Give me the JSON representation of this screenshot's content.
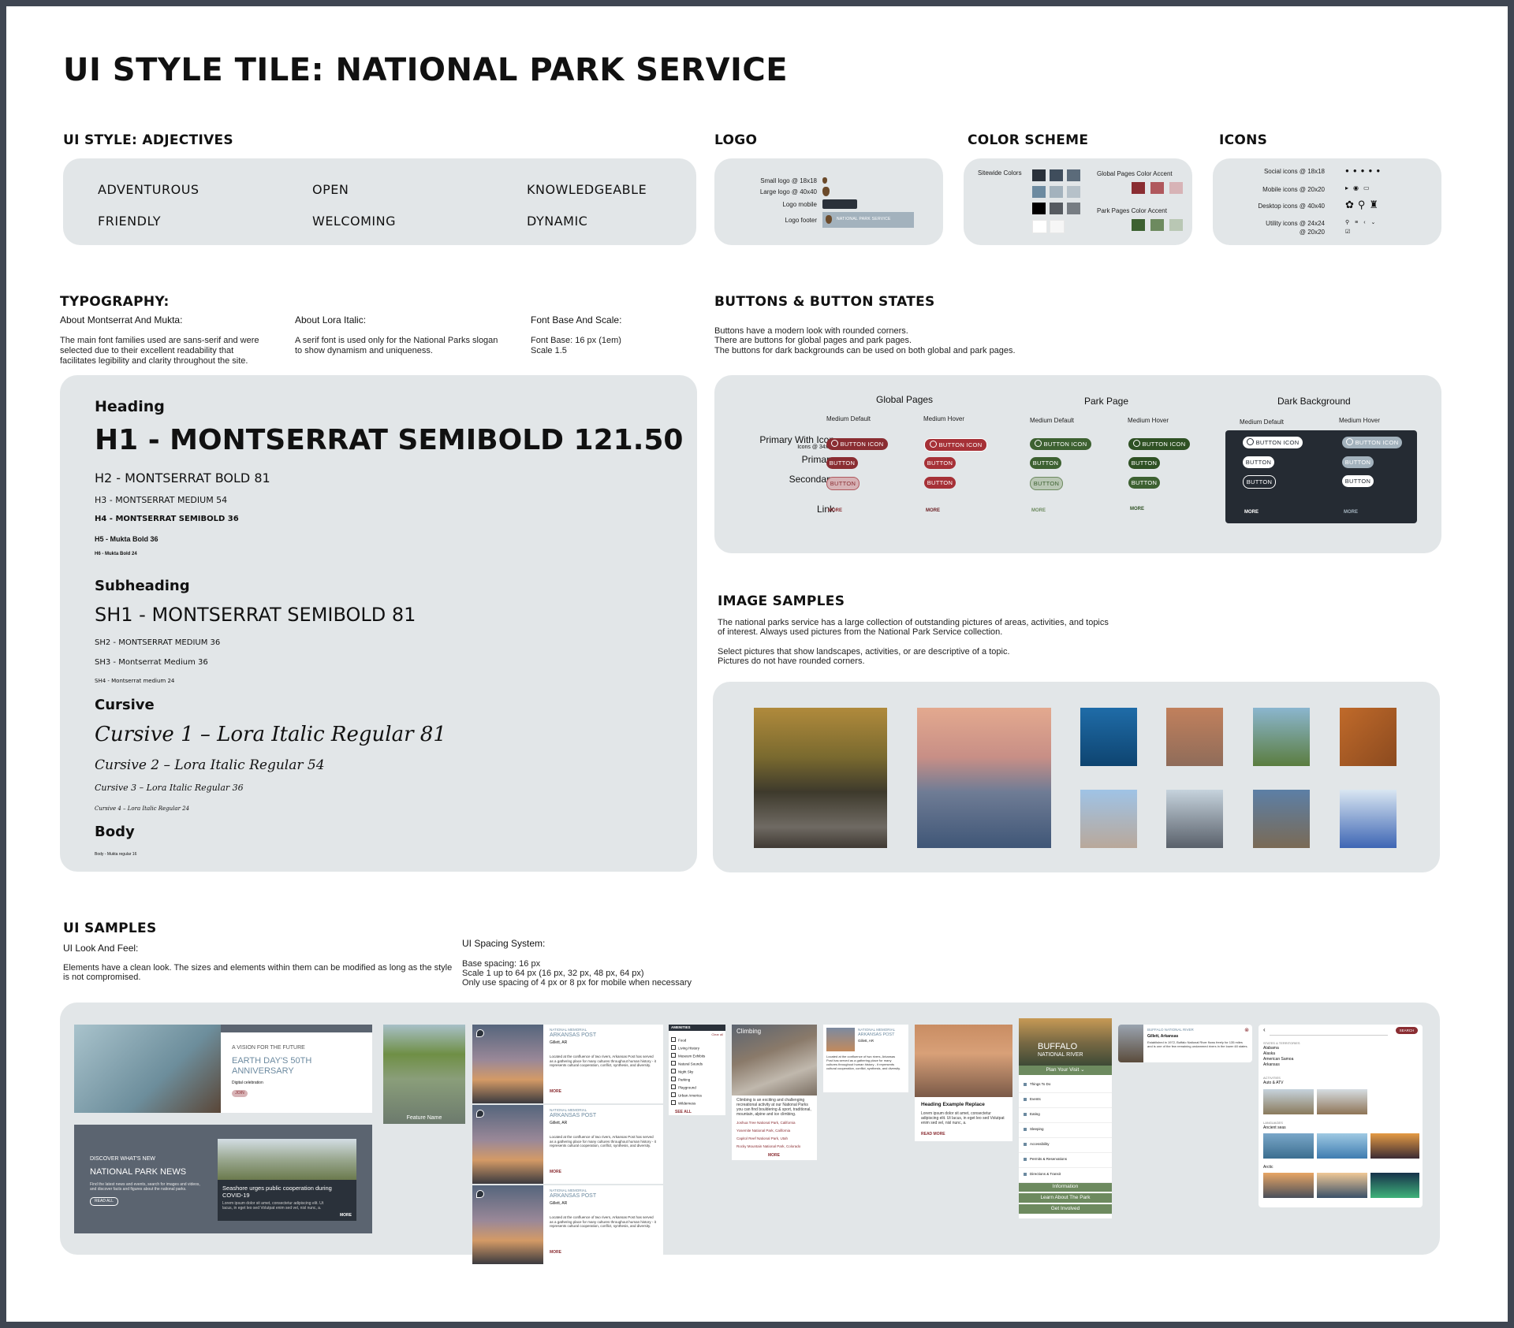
{
  "title": "UI STYLE TILE: NATIONAL PARK SERVICE",
  "adjectives": {
    "heading": "UI STYLE: ADJECTIVES",
    "words": [
      "ADVENTUROUS",
      "OPEN",
      "KNOWLEDGEABLE",
      "FRIENDLY",
      "WELCOMING",
      "DYNAMIC"
    ]
  },
  "logo": {
    "heading": "LOGO",
    "rows": [
      "Small logo @ 18x18",
      "Large logo @ 40x40",
      "Logo mobile",
      "Logo footer"
    ],
    "footer_text": "NATIONAL PARK SERVICE"
  },
  "color_scheme": {
    "heading": "COLOR SCHEME",
    "sitewide_label": "Sitewide Colors",
    "global_label": "Global Pages Color Accent",
    "park_label": "Park Pages Color Accent",
    "sitewide": [
      "#2a313a",
      "#3f4d5c",
      "#5b6b7a",
      "#6c8aa0",
      "#a3b2bd",
      "#b6c1c9",
      "#000000",
      "#555a60",
      "#777d83",
      "#ffffff",
      "#f6f6f6"
    ],
    "global": [
      "#8a2d32",
      "#b0585d",
      "#d7b3b6"
    ],
    "park": [
      "#3d6131",
      "#6d8a5f",
      "#b9c7b4"
    ]
  },
  "icons": {
    "heading": "ICONS",
    "rows": [
      "Social icons @ 18x18",
      "Mobile icons @ 20x20",
      "Desktop icons @ 40x40",
      "Utility icons @ 24x24",
      "@ 20x20"
    ]
  },
  "typography": {
    "heading": "TYPOGRAPHY:",
    "col1_title": "About Montserrat And Mukta:",
    "col1_text": "The main font families used are sans-serif and were selected due to their excellent readability that facilitates legibility and clarity throughout the site.",
    "col2_title": "About Lora Italic:",
    "col2_text": "A serif font is used only for the National Parks slogan to show dynamism and uniqueness.",
    "col3_title": "Font Base And Scale:",
    "col3_line1": "Font Base: 16 px (1em)",
    "col3_line2": "Scale 1.5",
    "heading_label": "Heading",
    "h1": "H1 - MONTSERRAT SEMIBOLD 121.50",
    "h2": "H2 - MONTSERRAT BOLD 81",
    "h3": "H3 - MONTSERRAT MEDIUM 54",
    "h4": "H4 - MONTSERRAT SEMIBOLD 36",
    "h5": "H5 - Mukta Bold 36",
    "h6": "H6 - Mukta Bold 24",
    "subheading_label": "Subheading",
    "sh1": "SH1 - MONTSERRAT SEMIBOLD 81",
    "sh2": "SH2 - MONTSERRAT MEDIUM 36",
    "sh3": "SH3 - Montserrat Medium 36",
    "sh4": "SH4 - Montserrat medium 24",
    "cursive_label": "Cursive",
    "c1": "Cursive 1 – Lora Italic Regular 81",
    "c2": "Cursive 2 – Lora Italic Regular 54",
    "c3": "Cursive 3 – Lora Italic Regular 36",
    "c4": "Cursive 4 – Lora Italic Regular 24",
    "body_label": "Body",
    "body_text": "Body - Mukta regular 16"
  },
  "buttons": {
    "heading": "BUTTONS & BUTTON STATES",
    "desc1": "Buttons have a modern look with rounded corners.",
    "desc2": "There are buttons for global pages and park pages.",
    "desc3": "The buttons for dark backgrounds can be used on both global and park pages.",
    "global_pages": "Global Pages",
    "park_page": "Park Page",
    "dark_background": "Dark Background",
    "medium_default": "Medium Default",
    "medium_hover": "Medium Hover",
    "row_primary_icon": "Primary With Icon",
    "row_primary_icon_sub": "Icons @ 34x34",
    "row_primary": "Primary",
    "row_secondary": "Secondary",
    "row_link": "Link",
    "button_icon": "BUTTON ICON",
    "button": "BUTTON",
    "more": "MORE",
    "colors": {
      "global": "#8a2d32",
      "global_hover": "#a63137",
      "park": "#3d6131",
      "park_hover": "#2f5124",
      "dark": "#252b33"
    }
  },
  "images": {
    "heading": "IMAGE SAMPLES",
    "desc1": "The national parks service has a large collection of outstanding pictures of areas, activities, and topics",
    "desc2": "of interest. Always used pictures from the National Park Service collection.",
    "desc3": "Select pictures that show landscapes, activities, or are descriptive of a topic.",
    "desc4": "Pictures do not have rounded corners."
  },
  "ui_samples": {
    "heading": "UI SAMPLES",
    "look_title": "UI Look And Feel:",
    "look_text1": "Elements have a clean look. The sizes and elements within them can be modified as long as the style",
    "look_text2": "is not compromised.",
    "spacing_title": "UI Spacing System:",
    "spacing1": "Base spacing: 16 px",
    "spacing2": "Scale 1 up to 64 px (16 px, 32 px, 48 px, 64 px)",
    "spacing3": "Only use spacing of 4 px or 8 px for mobile when necessary",
    "vision_kicker": "A VISION FOR THE FUTURE",
    "vision_title1": "EARTH DAY'S 50TH",
    "vision_title2": "ANNIVERSARY",
    "vision_sub": "Digital celebration",
    "vision_btn": "JOIN",
    "news_kicker": "DISCOVER WHAT'S NEW",
    "news_title": "NATIONAL PARK NEWS",
    "news_text": "Find the latest news and events, search for images and videos, and discover facts and figures about the national parks.",
    "news_btn": "READ ALL",
    "news_card_title": "Seashore urges public cooperation during COVID-19",
    "news_card_text": "Lorem ipsum dolor sit amet, consectetur adipiscing elit. Ut lacus, in eget leo sed Volutpat enim sed vel, nisl nunc, a.",
    "news_more": "MORE",
    "feature": "Feature Name",
    "memorial_kicker": "NATIONAL MEMORIAL",
    "memorial_title": "ARKANSAS POST",
    "memorial_loc": "Gillett, AR",
    "memorial_text": "Located at the confluence of two rivers, Arkansas Post has served as a gathering place for many cultures throughout human history - it represents cultural cooperation, conflict, synthesis, and diversity.",
    "amenities": "AMENITIES",
    "clear_all": "Clear all",
    "amenity_items": [
      "Food",
      "Living History",
      "Museum Exhibits",
      "Natural Sounds",
      "Night Sky",
      "Parking",
      "Playground",
      "Urban America",
      "Wilderness"
    ],
    "see_all": "SEE ALL",
    "climbing": "Climbing",
    "climbing_text": "Climbing is an exciting and challenging recreational activity at our National Parks you can find bouldering & sport, traditional, mountain, alpine and ice climbing.",
    "climbing_links": [
      "Joshua Tree National Park, California",
      "Yosemite National Park, California",
      "Capitol Reef National Park, Utah",
      "Rocky Mountain National Park, Colorado"
    ],
    "heading_example": "Heading Example Replace",
    "read_more": "READ MORE",
    "buffalo1": "BUFFALO",
    "buffalo2": "NATIONAL RIVER",
    "plan_visit": "Plan Your Visit",
    "menu_items": [
      "Things To Do",
      "Events",
      "Eating",
      "Sleeping",
      "Accessibility",
      "Permits & Reservations",
      "Directions & Transit"
    ],
    "information": "Information",
    "learn_about": "Learn About The Park",
    "get_involved": "Get Involved",
    "river_kicker": "BUFFALO NATIONAL RIVER",
    "river_loc": "Gillett, Arkansas",
    "river_text": "Established in 1972, Buffalo National River flows freely for 135 miles and is one of the few remaining undammed rivers in the lower 48 states.",
    "search": "SEARCH",
    "states_label": "STATES & TERRITORIES",
    "states": [
      "Alabama",
      "Alaska",
      "American Samoa",
      "Arkansas"
    ],
    "activities_label": "ACTIVITIES",
    "activities": [
      "Auto & ATV"
    ],
    "languages_label": "LANGUAGES",
    "languages": [
      "Ancient seas"
    ],
    "arctic": "Arctic",
    "search_more": "MORE"
  }
}
